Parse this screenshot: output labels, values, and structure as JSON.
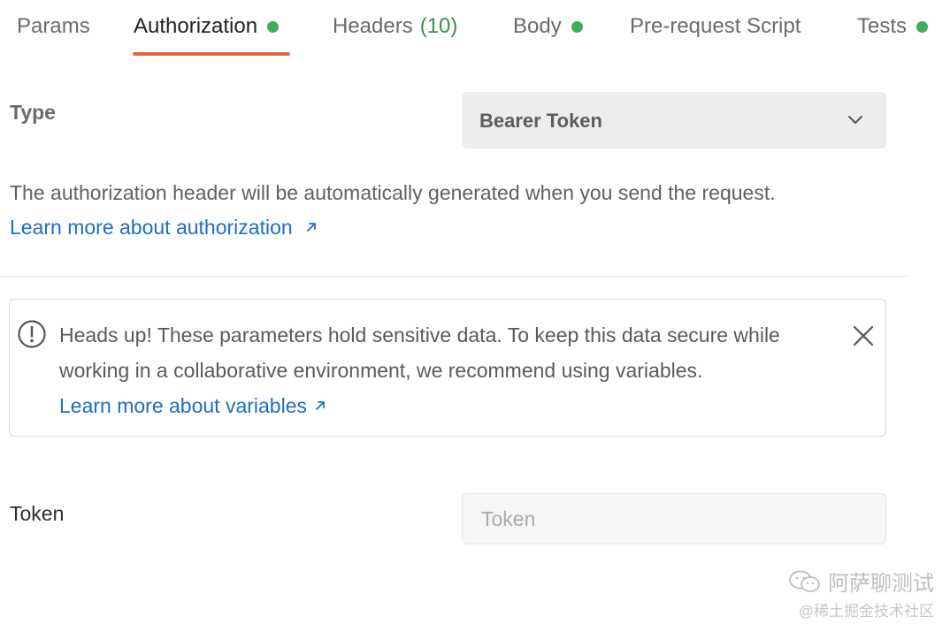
{
  "tabs": [
    {
      "label": "Params",
      "dot": false
    },
    {
      "label": "Authorization",
      "dot": true,
      "active": true
    },
    {
      "label": "Headers",
      "count": "(10)",
      "dot": false
    },
    {
      "label": "Body",
      "dot": true
    },
    {
      "label": "Pre-request Script",
      "dot": false
    },
    {
      "label": "Tests",
      "dot": true
    }
  ],
  "colors": {
    "accent": "#e2693e",
    "status_dot": "#3fae5a",
    "link": "#1f6dc4"
  },
  "auth": {
    "type_label": "Type",
    "type_value": "Bearer Token",
    "description": "The authorization header will be automatically generated when you send the request.",
    "learn_more": "Learn more about authorization"
  },
  "warning": {
    "icon": "exclamation-circle-icon",
    "text": "Heads up! These parameters hold sensitive data. To keep this data secure while working in a collaborative environment, we recommend using variables.",
    "link": "Learn more about variables"
  },
  "token": {
    "label": "Token",
    "placeholder": "Token",
    "value": ""
  },
  "watermark": {
    "main": "阿萨聊测试",
    "sub": "@稀土掘金技术社区"
  }
}
